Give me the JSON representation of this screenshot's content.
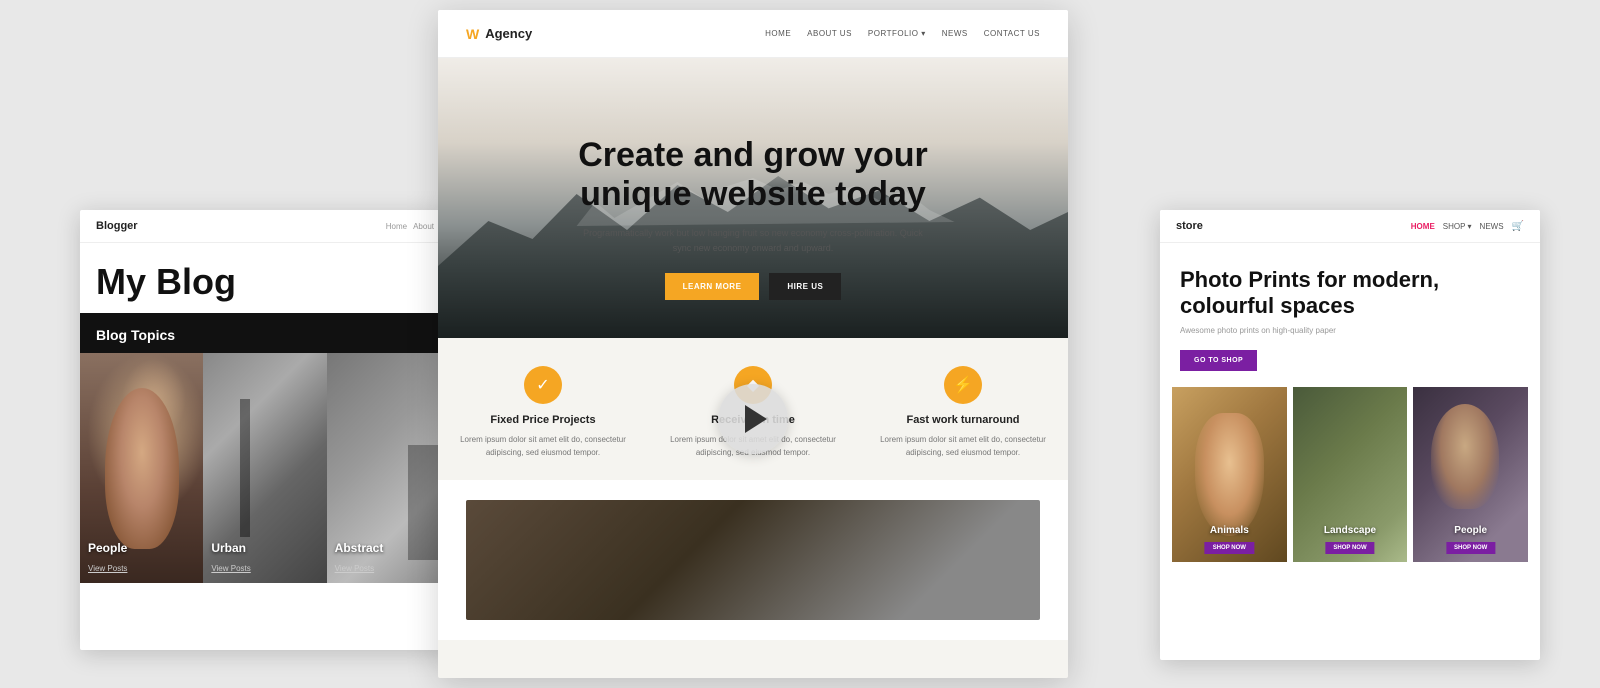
{
  "background_color": "#e8e8e8",
  "blogger": {
    "logo": "Blogger",
    "nav": [
      "Home",
      "About"
    ],
    "title": "My Blog",
    "topics_label": "Blog Topics",
    "cards": [
      {
        "id": "people",
        "label": "People",
        "link": "View Posts"
      },
      {
        "id": "urban",
        "label": "Urban",
        "link": "View Posts"
      },
      {
        "id": "abstract",
        "label": "Abstract",
        "link": "View Posts"
      }
    ]
  },
  "agency": {
    "logo_icon": "W",
    "logo_text": "Agency",
    "nav": [
      "HOME",
      "ABOUT US",
      "PORTFOLIO",
      "NEWS",
      "CONTACT US"
    ],
    "hero_title_line1": "Create and grow your",
    "hero_title_line2": "unique website today",
    "hero_sub": "Programmatically work but low hanging fruit so new economy cross-pollination. Quick sync new economy onward and upward.",
    "btn_learn": "LEARN MORE",
    "btn_hire": "HIRE US",
    "features": [
      {
        "icon": "✓",
        "title": "Fixed Price Projects",
        "desc": "Lorem ipsum dolor sit amet elit do, consectetur adipiscing, sed eiusmod tempor."
      },
      {
        "icon": "◆",
        "title": "Receive on time",
        "desc": "Lorem ipsum dolor sit amet elit do, consectetur adipiscing, sed eiusmod tempor."
      },
      {
        "icon": "⚡",
        "title": "Fast work turnaround",
        "desc": "Lorem ipsum dolor sit amet elit do, consectetur adipiscing, sed eiusmod tempor."
      }
    ]
  },
  "store": {
    "logo": "store",
    "nav": [
      "HOME",
      "SHOP",
      "NEWS",
      "🛒"
    ],
    "title_line1": "Photo Prints for modern,",
    "title_line2": "colourful spaces",
    "sub": "Awesome photo prints on high-quality paper",
    "btn_shop": "GO TO SHOP",
    "images": [
      {
        "id": "animals",
        "label": "Animals",
        "btn": "SHOP NOW"
      },
      {
        "id": "landscape",
        "label": "Landscape",
        "btn": "SHOP NOW"
      },
      {
        "id": "people",
        "label": "People",
        "btn": "SHOP NOW"
      }
    ]
  }
}
